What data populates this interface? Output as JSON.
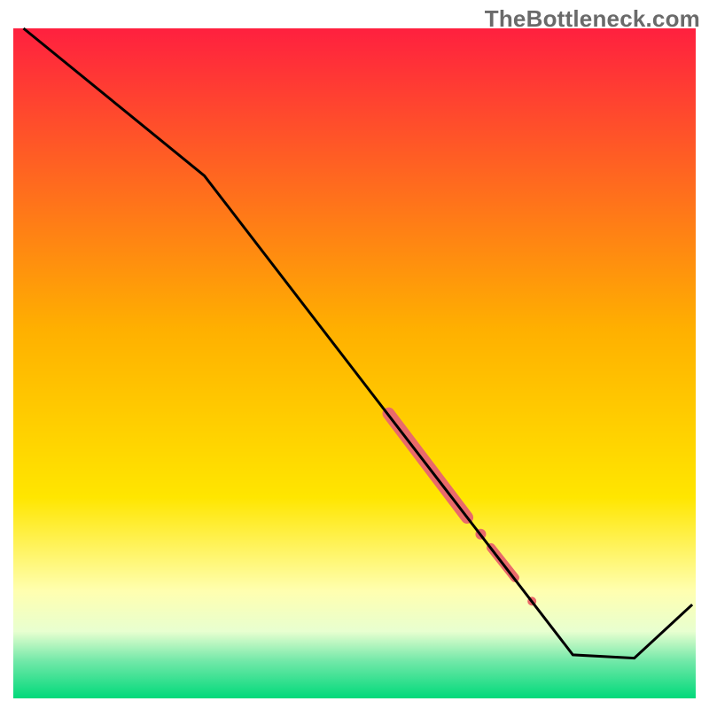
{
  "watermark": "TheBottleneck.com",
  "chart_data": {
    "type": "line",
    "title": "",
    "xlabel": "",
    "ylabel": "",
    "xlim": [
      0,
      100
    ],
    "ylim": [
      0,
      100
    ],
    "background_gradient": {
      "stops": [
        {
          "offset": 0.0,
          "color": "#ff203f"
        },
        {
          "offset": 0.45,
          "color": "#ffb000"
        },
        {
          "offset": 0.7,
          "color": "#ffe600"
        },
        {
          "offset": 0.84,
          "color": "#ffffb0"
        },
        {
          "offset": 0.9,
          "color": "#e8ffd0"
        },
        {
          "offset": 0.945,
          "color": "#70e8a8"
        },
        {
          "offset": 1.0,
          "color": "#00d97a"
        }
      ]
    },
    "series": [
      {
        "name": "bottleneck-curve",
        "color": "#000000",
        "points": [
          {
            "x": 1.5,
            "y": 100
          },
          {
            "x": 28,
            "y": 78
          },
          {
            "x": 82,
            "y": 6.5
          },
          {
            "x": 91,
            "y": 6
          },
          {
            "x": 99.5,
            "y": 14
          }
        ]
      }
    ],
    "highlight_segments": [
      {
        "name": "highlight-thick-upper",
        "color": "#e96a6a",
        "width": 14,
        "points": [
          {
            "x": 55,
            "y": 42.5
          },
          {
            "x": 66.5,
            "y": 27
          }
        ]
      },
      {
        "name": "highlight-dot-1",
        "color": "#e96a6a",
        "radius": 6,
        "point": {
          "x": 68.5,
          "y": 24.5
        }
      },
      {
        "name": "highlight-thick-lower",
        "color": "#e96a6a",
        "width": 10,
        "points": [
          {
            "x": 70,
            "y": 22.5
          },
          {
            "x": 73.5,
            "y": 18
          }
        ]
      },
      {
        "name": "highlight-dot-2",
        "color": "#e96a6a",
        "radius": 5,
        "point": {
          "x": 76,
          "y": 14.5
        }
      }
    ]
  }
}
